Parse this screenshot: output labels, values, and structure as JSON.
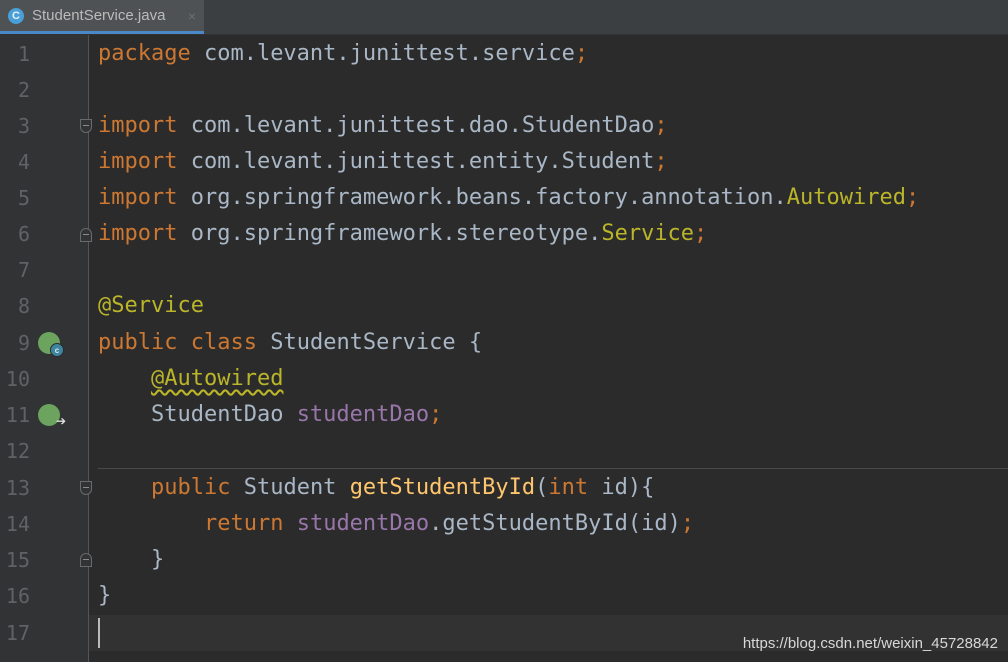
{
  "tab": {
    "icon_letter": "C",
    "title": "StudentService.java",
    "close_glyph": "×"
  },
  "line_numbers": [
    "1",
    "2",
    "3",
    "4",
    "5",
    "6",
    "7",
    "8",
    "9",
    "10",
    "11",
    "12",
    "13",
    "14",
    "15",
    "16",
    "17"
  ],
  "code": {
    "l1": {
      "kw": "package",
      "rest": " com.levant.junittest.service",
      "semi": ";"
    },
    "l3": {
      "kw": "import",
      "rest": " com.levant.junittest.dao.StudentDao",
      "semi": ";"
    },
    "l4": {
      "kw": "import",
      "rest": " com.levant.junittest.entity.Student",
      "semi": ";"
    },
    "l5": {
      "kw": "import",
      "rest": " org.springframework.beans.factory.annotation.",
      "cls": "Autowired",
      "semi": ";"
    },
    "l6": {
      "kw": "import",
      "rest": " org.springframework.stereotype.",
      "cls": "Service",
      "semi": ";"
    },
    "l8": {
      "ann": "@Service"
    },
    "l9": {
      "kw1": "public",
      "kw2": "class",
      "rest": " StudentService {"
    },
    "l10": {
      "indent": "    ",
      "ann": "@Autowired"
    },
    "l11": {
      "indent": "    ",
      "type": "StudentDao ",
      "field": "studentDao",
      "semi": ";"
    },
    "l13": {
      "indent": "    ",
      "kw": "public",
      "type": " Student ",
      "method": "getStudentById",
      "open": "(",
      "kw2": "int",
      "rest": " id){"
    },
    "l14": {
      "indent": "        ",
      "kw": "return",
      "field": "studentDao",
      "rest": ".getStudentById(id)",
      "semi": ";"
    },
    "l15": {
      "indent": "    ",
      "rest": "}"
    },
    "l16": {
      "rest": "}"
    }
  },
  "watermark": "https://blog.csdn.net/weixin_45728842",
  "colors": {
    "background": "#2b2b2b",
    "keyword": "#cc7832",
    "annotation": "#bbb529",
    "field": "#9876aa",
    "method": "#ffc66d",
    "text": "#a9b7c6"
  }
}
